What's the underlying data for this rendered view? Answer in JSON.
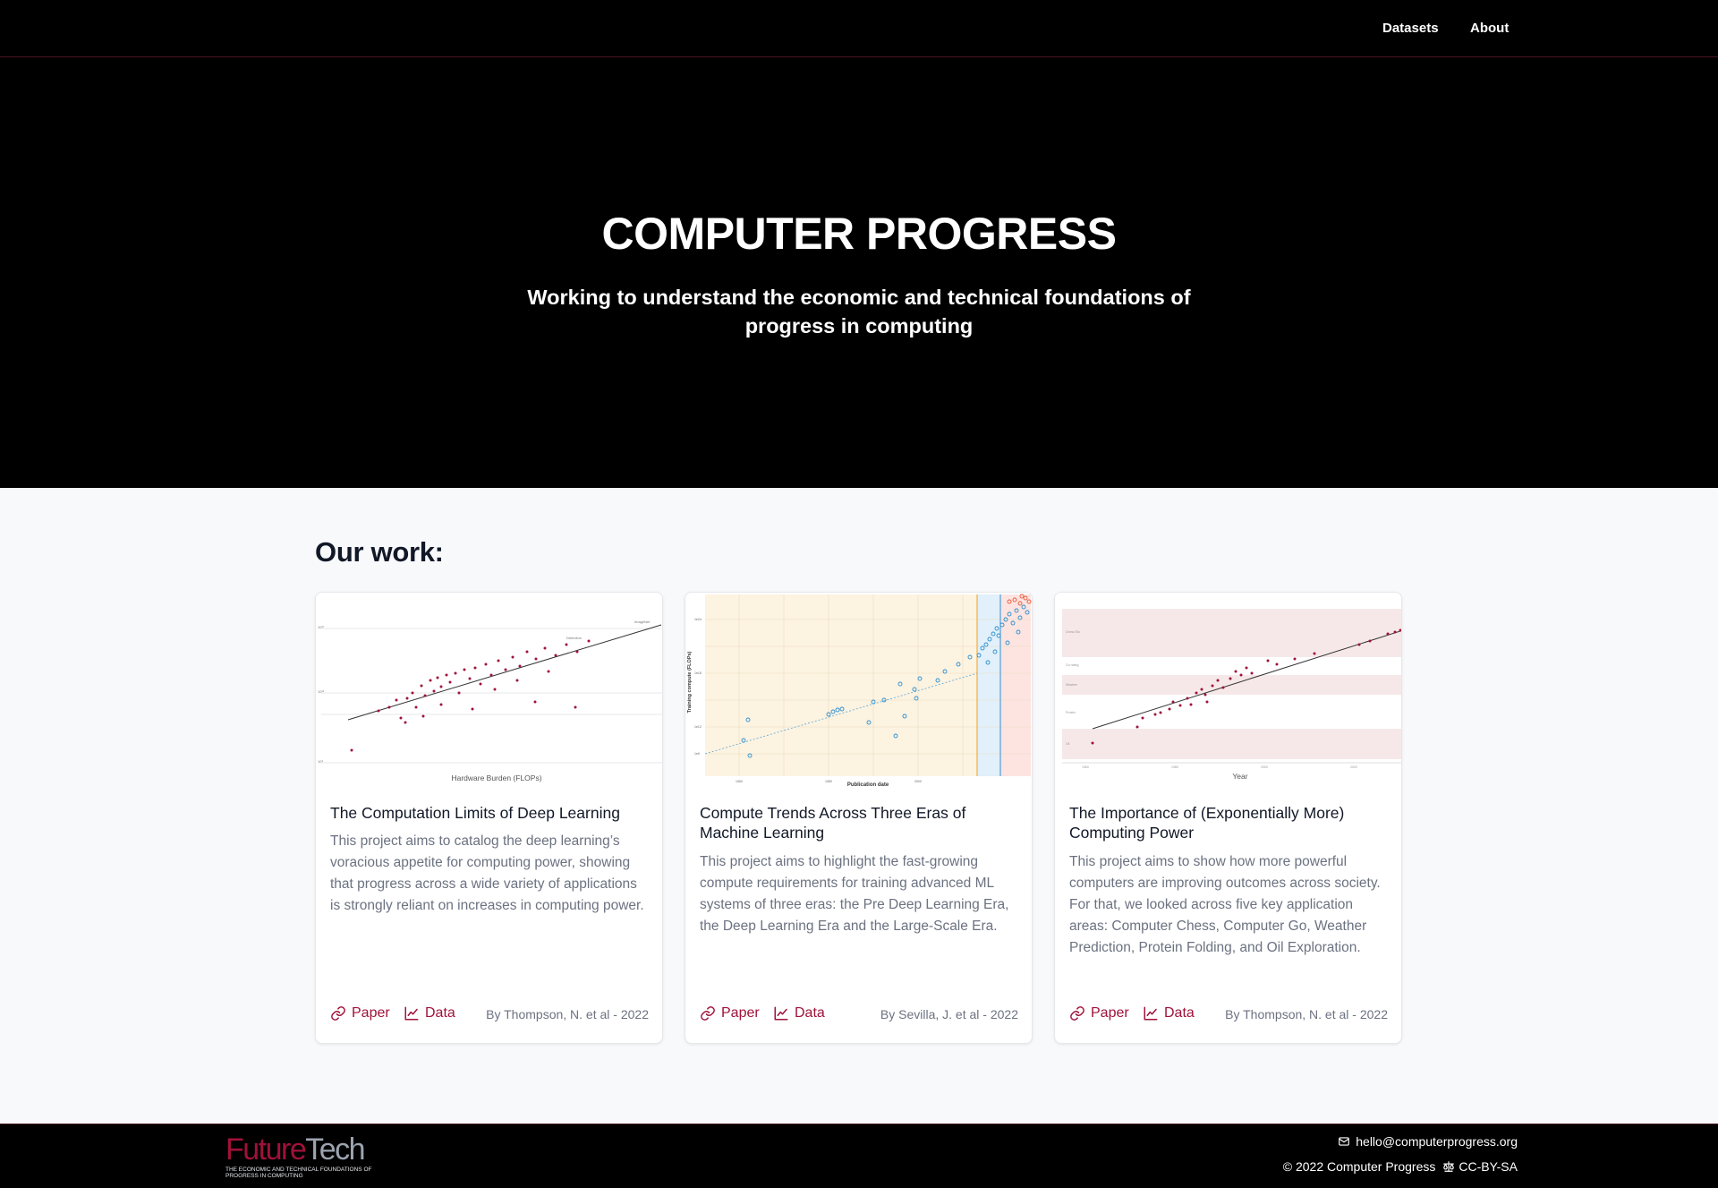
{
  "nav": {
    "datasets": "Datasets",
    "about": "About"
  },
  "hero": {
    "title": "COMPUTER PROGRESS",
    "subtitle": "Working to understand the economic and technical foundations of progress in computing"
  },
  "section_title": "Our work:",
  "cards": [
    {
      "title": "The Computation Limits of Deep Learning",
      "description": "This project aims to catalog the deep learning’s voracious appetite for computing power, showing that progress across a wide variety of applications is strongly reliant on increases in computing power.",
      "paper": "Paper",
      "data": "Data",
      "byline": "By Thompson, N. et al",
      "year": "2022",
      "thumb_xlabel": "Hardware Burden (FLOPs)"
    },
    {
      "title": "Compute Trends Across Three Eras of Machine Learning",
      "description": "This project aims to highlight the fast-growing compute requirements for training advanced ML systems of three eras: the Pre Deep Learning Era, the Deep Learning Era and the Large-Scale Era.",
      "paper": "Paper",
      "data": "Data",
      "byline": "By Sevilla, J. et al",
      "year": "2022",
      "thumb_xlabel": "Publication date",
      "thumb_ylabel": "Training compute (FLOPs)"
    },
    {
      "title": "The Importance of (Exponentially More) Computing Power",
      "description": "This project aims to show how more powerful computers are improving outcomes across society. For that, we looked across five key application areas: Computer Chess, Computer Go, Weather Prediction, Protein Folding, and Oil Exploration.",
      "paper": "Paper",
      "data": "Data",
      "byline": "By Thompson, N. et al",
      "year": "2022",
      "thumb_xlabel": "Year"
    }
  ],
  "footer": {
    "logo_future": "Future",
    "logo_tech": "Tech",
    "logo_sub": "THE ECONOMIC AND TECHNICAL FOUNDATIONS OF PROGRESS IN COMPUTING",
    "email": "hello@computerprogress.org",
    "copyright": "© 2022 Computer Progress",
    "license": "CC-BY-SA"
  },
  "colors": {
    "accent": "#9f1239",
    "background": "#000000",
    "page": "#f8f9fb"
  },
  "icons": {
    "link": "link-icon",
    "chart": "chart-line-icon",
    "mail": "mail-icon",
    "license": "scale-icon"
  }
}
